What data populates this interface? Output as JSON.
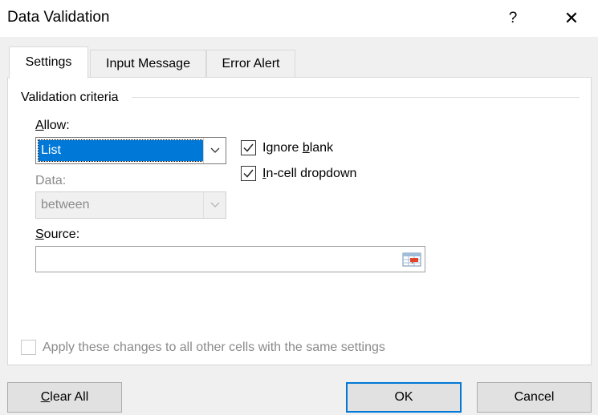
{
  "dialog": {
    "title": "Data Validation",
    "help_label": "?",
    "close_label": "✕"
  },
  "tabs": [
    {
      "label": "Settings",
      "active": true
    },
    {
      "label": "Input Message",
      "active": false
    },
    {
      "label": "Error Alert",
      "active": false
    }
  ],
  "criteria": {
    "group_label": "Validation criteria",
    "allow": {
      "label_ul": "A",
      "label_rest": "llow:",
      "value": "List"
    },
    "data": {
      "label": "Data:",
      "value": "between"
    },
    "ignore_blank": {
      "label_pre": "Ignore ",
      "label_ul": "b",
      "label_post": "lank",
      "checked": true
    },
    "in_cell_dropdown": {
      "label_ul": "I",
      "label_rest": "n-cell dropdown",
      "checked": true
    },
    "source": {
      "label_ul": "S",
      "label_rest": "ource:",
      "value": ""
    }
  },
  "apply_all": {
    "label": "Apply these changes to all other cells with the same settings",
    "checked": false
  },
  "buttons": {
    "clear_all_ul": "C",
    "clear_all_rest": "lear All",
    "ok": "OK",
    "cancel": "Cancel"
  },
  "colors": {
    "accent": "#0078d7",
    "background": "#f0f0f0"
  }
}
